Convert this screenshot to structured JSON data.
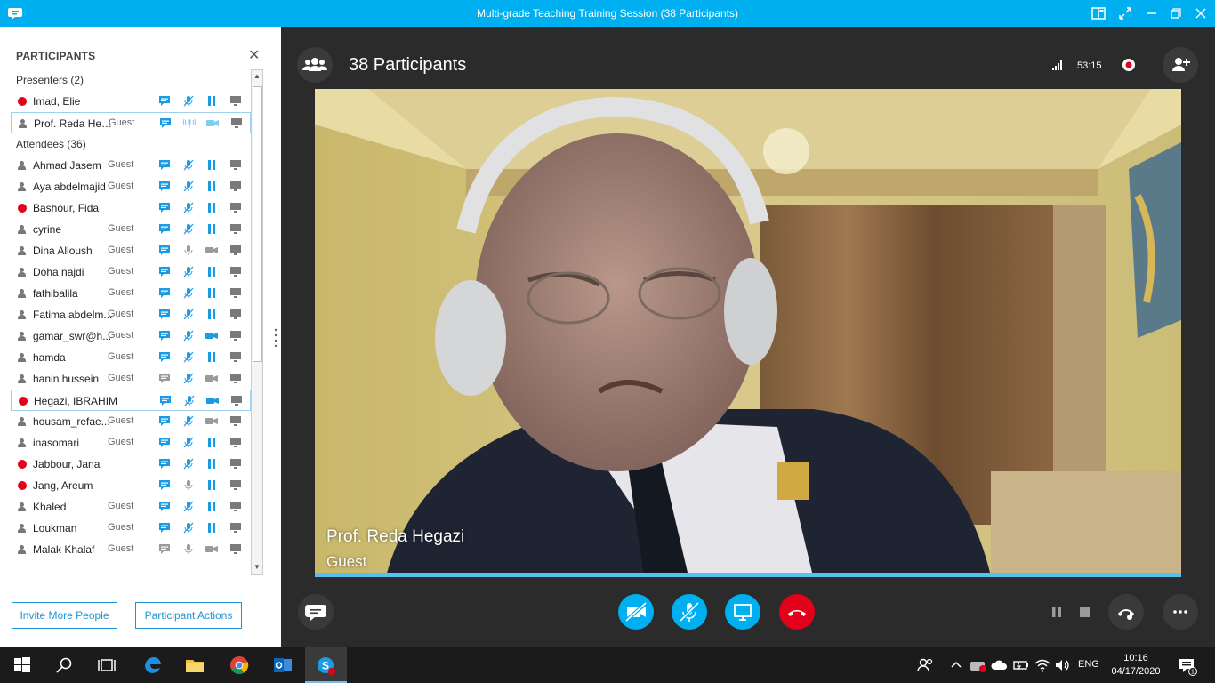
{
  "window": {
    "title": "Multi-grade Teaching Training Session (38 Participants)"
  },
  "panel": {
    "header": "PARTICIPANTS",
    "presenters_label": "Presenters (2)",
    "attendees_label": "Attendees (36)",
    "presenters": [
      {
        "name": "Imad, Elie",
        "guest": "",
        "status": "red",
        "chat": "blue",
        "mic": "muted",
        "video": "paused",
        "selected": false
      },
      {
        "name": "Prof. Reda Heg...",
        "guest": "Guest",
        "status": "person",
        "chat": "blue",
        "mic": "active",
        "video": "active-light",
        "selected": true
      }
    ],
    "attendees": [
      {
        "name": "Ahmad Jasem",
        "guest": "Guest",
        "status": "person",
        "chat": "blue",
        "mic": "muted",
        "video": "paused"
      },
      {
        "name": "Aya abdelmajid",
        "guest": "Guest",
        "status": "person",
        "chat": "blue",
        "mic": "muted",
        "video": "paused"
      },
      {
        "name": "Bashour, Fida",
        "guest": "",
        "status": "red",
        "chat": "blue",
        "mic": "muted",
        "video": "paused"
      },
      {
        "name": "cyrine",
        "guest": "Guest",
        "status": "person",
        "chat": "blue",
        "mic": "muted",
        "video": "paused"
      },
      {
        "name": "Dina Alloush",
        "guest": "Guest",
        "status": "person",
        "chat": "blue",
        "mic": "gray",
        "video": "gray"
      },
      {
        "name": "Doha najdi",
        "guest": "Guest",
        "status": "person",
        "chat": "blue",
        "mic": "muted",
        "video": "paused"
      },
      {
        "name": "fathibalila",
        "guest": "Guest",
        "status": "person",
        "chat": "blue",
        "mic": "muted",
        "video": "paused"
      },
      {
        "name": "Fatima abdelm...",
        "guest": "Guest",
        "status": "person",
        "chat": "blue",
        "mic": "muted",
        "video": "paused"
      },
      {
        "name": "gamar_swr@h...",
        "guest": "Guest",
        "status": "person",
        "chat": "blue",
        "mic": "muted",
        "video": "blue"
      },
      {
        "name": "hamda",
        "guest": "Guest",
        "status": "person",
        "chat": "blue",
        "mic": "muted",
        "video": "paused"
      },
      {
        "name": "hanin hussein",
        "guest": "Guest",
        "status": "person",
        "chat": "gray",
        "mic": "muted",
        "video": "gray"
      },
      {
        "name": "Hegazi, IBRAHIM",
        "guest": "",
        "status": "red",
        "chat": "blue",
        "mic": "muted",
        "video": "blue",
        "selected": true
      },
      {
        "name": "housam_refae...",
        "guest": "Guest",
        "status": "person",
        "chat": "blue",
        "mic": "muted",
        "video": "gray"
      },
      {
        "name": "inasomari",
        "guest": "Guest",
        "status": "person",
        "chat": "blue",
        "mic": "muted",
        "video": "paused"
      },
      {
        "name": "Jabbour, Jana",
        "guest": "",
        "status": "red",
        "chat": "blue",
        "mic": "muted",
        "video": "paused"
      },
      {
        "name": "Jang, Areum",
        "guest": "",
        "status": "red",
        "chat": "blue",
        "mic": "gray",
        "video": "paused"
      },
      {
        "name": "Khaled",
        "guest": "Guest",
        "status": "person",
        "chat": "blue",
        "mic": "muted",
        "video": "paused"
      },
      {
        "name": "Loukman",
        "guest": "Guest",
        "status": "person",
        "chat": "blue",
        "mic": "muted",
        "video": "paused"
      },
      {
        "name": "Malak Khalaf",
        "guest": "Guest",
        "status": "person",
        "chat": "gray",
        "mic": "gray",
        "video": "gray"
      }
    ],
    "invite_label": "Invite More People",
    "actions_label": "Participant Actions"
  },
  "call": {
    "participants_count": "38 Participants",
    "timer": "53:15",
    "speaker_name": "Prof. Reda Hegazi",
    "speaker_role": "Guest"
  },
  "taskbar": {
    "lang": "ENG",
    "time": "10:16",
    "date": "04/17/2020",
    "notifications": "1"
  },
  "colors": {
    "accent": "#00aff0",
    "hangup": "#e3001b",
    "presence_busy": "#e3001b",
    "panel_button": "#1e95d3"
  }
}
